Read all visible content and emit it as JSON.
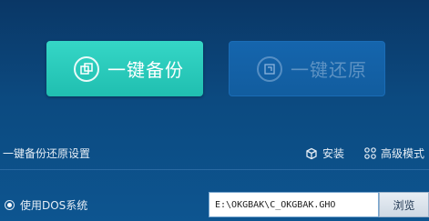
{
  "actions": {
    "backup_label": "一键备份",
    "restore_label": "一键还原"
  },
  "settings": {
    "title": "一键备份还原设置",
    "install_label": "安装",
    "advanced_label": "高级模式",
    "use_dos_label": "使用DOS系统",
    "use_dos_selected": true,
    "ghost_path": "E:\\OKGBAK\\C_OKGBAK.GHO",
    "browse_label": "浏览"
  }
}
